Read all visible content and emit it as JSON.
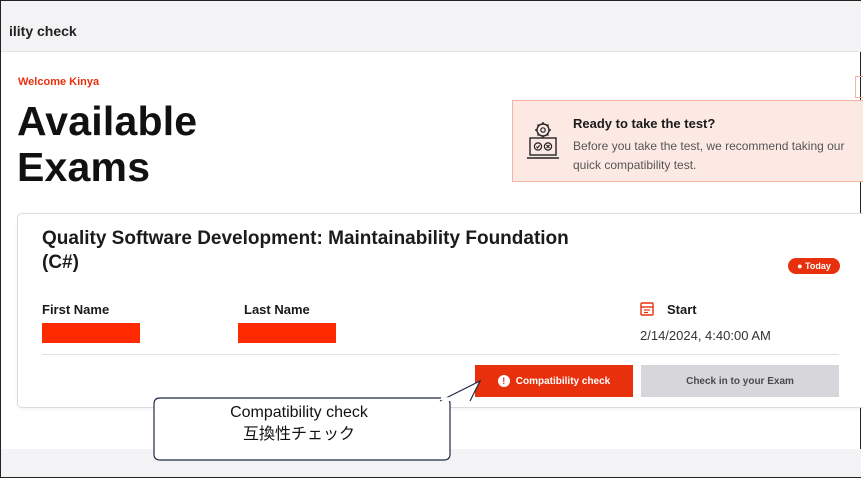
{
  "topbar": {
    "title": "ility check"
  },
  "welcome": "Welcome Kinya",
  "page_title_line1": "Available",
  "page_title_line2": "Exams",
  "ready": {
    "title": "Ready to take the test?",
    "text": "Before you take the test, we recommend taking our quick compatibility test.",
    "icon": "computer-gear-icon"
  },
  "exam": {
    "title": "Quality Software Development: Maintainability Foundation (C#)",
    "badge": "Today",
    "first_name_label": "First Name",
    "last_name_label": "Last Name",
    "start_label": "Start",
    "start_date": "2/14/2024, 4:40:00 AM",
    "compat_button": "Compatibility check",
    "checkin_button": "Check in to your Exam"
  },
  "callout": {
    "line1": "Compatibility check",
    "line2": "互換性チェック"
  },
  "colors": {
    "accent": "#e8300d",
    "ready_bg": "#fde9e4",
    "redaction": "#ff2a00"
  }
}
